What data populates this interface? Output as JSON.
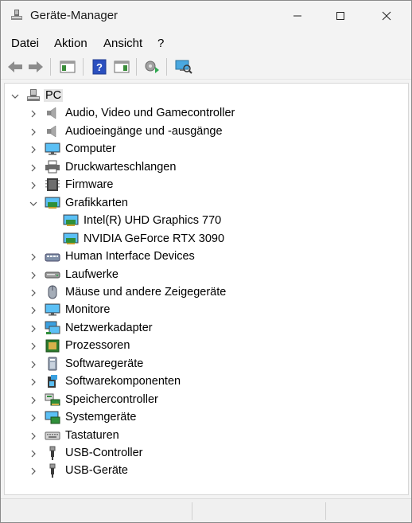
{
  "window": {
    "title": "Geräte-Manager"
  },
  "menu": {
    "items": [
      {
        "label": "Datei"
      },
      {
        "label": "Aktion"
      },
      {
        "label": "Ansicht"
      },
      {
        "label": "?"
      }
    ]
  },
  "toolbar": {
    "buttons": [
      "back-arrow-icon",
      "forward-arrow-icon",
      "show-hide-tree-icon",
      "help-icon",
      "properties-icon",
      "update-driver-icon",
      "scan-hardware-icon"
    ]
  },
  "tree": {
    "root": {
      "label": "PC",
      "expanded": true
    },
    "categories": [
      {
        "label": "Audio, Video und Gamecontroller",
        "icon": "speaker-icon"
      },
      {
        "label": "Audioeingänge und -ausgänge",
        "icon": "speaker-icon"
      },
      {
        "label": "Computer",
        "icon": "monitor-icon"
      },
      {
        "label": "Druckwarteschlangen",
        "icon": "printer-icon"
      },
      {
        "label": "Firmware",
        "icon": "chip-icon"
      },
      {
        "label": "Grafikkarten",
        "icon": "display-adapter-icon",
        "expanded": true,
        "children": [
          {
            "label": "Intel(R) UHD Graphics 770"
          },
          {
            "label": "NVIDIA GeForce RTX 3090"
          }
        ]
      },
      {
        "label": "Human Interface Devices",
        "icon": "hid-icon"
      },
      {
        "label": "Laufwerke",
        "icon": "drive-icon"
      },
      {
        "label": "Mäuse und andere Zeigegeräte",
        "icon": "mouse-icon"
      },
      {
        "label": "Monitore",
        "icon": "monitor-icon"
      },
      {
        "label": "Netzwerkadapter",
        "icon": "network-icon"
      },
      {
        "label": "Prozessoren",
        "icon": "processor-icon"
      },
      {
        "label": "Softwaregeräte",
        "icon": "software-device-icon"
      },
      {
        "label": "Softwarekomponenten",
        "icon": "software-component-icon"
      },
      {
        "label": "Speichercontroller",
        "icon": "storage-controller-icon"
      },
      {
        "label": "Systemgeräte",
        "icon": "system-device-icon"
      },
      {
        "label": "Tastaturen",
        "icon": "keyboard-icon"
      },
      {
        "label": "USB-Controller",
        "icon": "usb-icon"
      },
      {
        "label": "USB-Geräte",
        "icon": "usb-icon"
      }
    ]
  },
  "colors": {
    "background": "#f3f3f3",
    "panel": "#ffffff",
    "accent": "#0078d4"
  }
}
